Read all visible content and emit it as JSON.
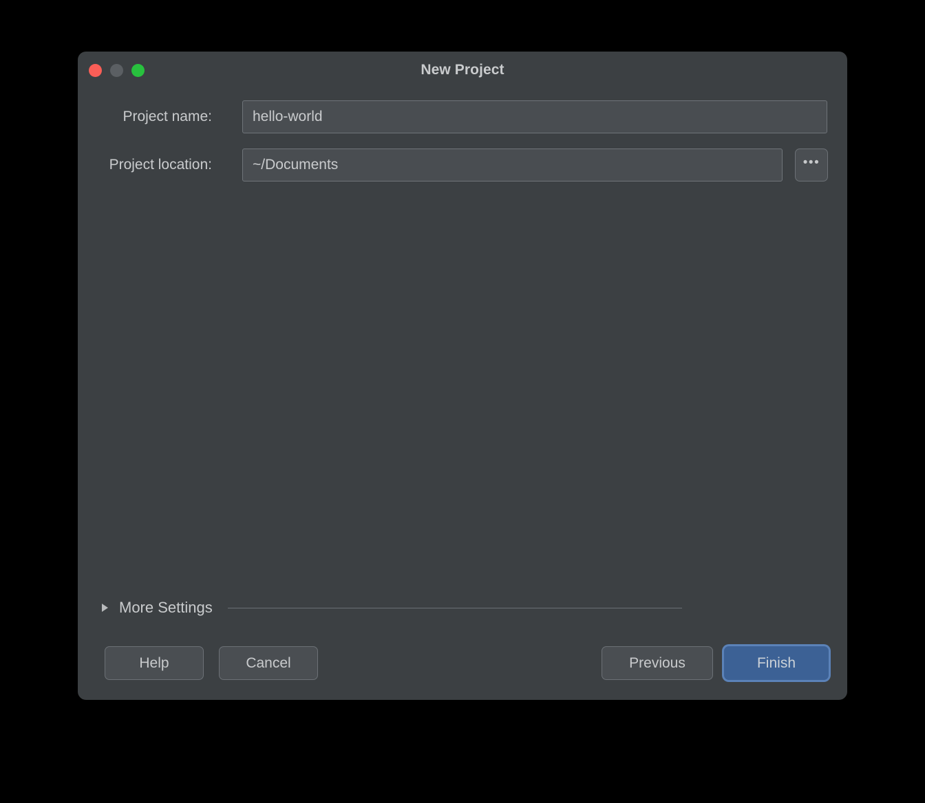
{
  "window": {
    "title": "New Project",
    "traffic_lights": [
      {
        "name": "close",
        "color": "#fa5e57"
      },
      {
        "name": "minimize",
        "color": "#5b5f63"
      },
      {
        "name": "zoom",
        "color": "#28c13e"
      }
    ]
  },
  "form": {
    "project_name": {
      "label": "Project name:",
      "value": "hello-world",
      "placeholder": ""
    },
    "project_location": {
      "label": "Project location:",
      "value": "~/Documents",
      "placeholder": "",
      "browse_label": "•••"
    }
  },
  "more_settings": {
    "label": "More Settings",
    "expanded": false,
    "disclosure_icon": "triangle-right-icon"
  },
  "footer": {
    "help_label": "Help",
    "cancel_label": "Cancel",
    "previous_label": "Previous",
    "finish_label": "Finish"
  },
  "colors": {
    "dialog_background": "#3c4043",
    "field_background": "#494d51",
    "field_border": "#6f7479",
    "text": "#c9cbcd",
    "button_background": "#4a4e52",
    "accent_blue": "#3c6195",
    "focus_ring": "#5b82b8",
    "page_background": "#000000"
  }
}
